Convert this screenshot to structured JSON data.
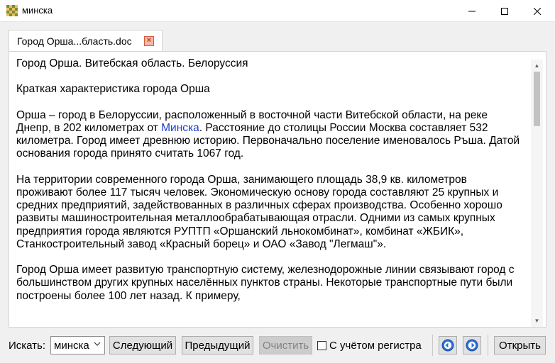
{
  "window": {
    "title": "минска",
    "controls": {
      "minimize": "—",
      "maximize": "☐",
      "close": "✕"
    }
  },
  "tab": {
    "label": "Город Орша...бласть.doc",
    "close_glyph": "×"
  },
  "document": {
    "paragraphs": [
      "Город Орша. Витебская область. Белоруссия",
      "Краткая характеристика города Орша"
    ],
    "para3_before_link": "Орша – город в Белоруссии, расположенный в восточной части Витебской области, на реке Днепр, в 202 километрах от ",
    "para3_link": "Минска",
    "para3_after_link": ". Расстояние до столицы России Москва составляет 532 километра. Город имеет древнюю историю. Первоначально поселение именовалось Ръша. Датой основания города принято считать 1067 год.",
    "para4": "На территории современного города Орша, занимающего площадь 38,9 кв. километров проживают более 117 тысяч человек. Экономическую основу города составляют 25 крупных и средних предприятий, задействованных в различных сферах производства. Особенно хорошо развиты машиностроительная металлообрабатывающая отрасли. Одними из самых крупных предприятия города являются РУПТП «Оршанский льнокомбинат», комбинат «ЖБИК», Станкостроительный завод «Красный борец» и ОАО «Завод \"Легмаш\"».",
    "para5": "Город Орша имеет развитую транспортную систему, железнодорожные линии связывают город с большинством других крупных населённых пунктов страны. Некоторые транспортные пути были построены более 100 лет назад. К примеру,"
  },
  "toolbar": {
    "search_label": "Искать:",
    "search_value": "минска",
    "next_label": "Следующий",
    "prev_label": "Предыдущий",
    "clear_label": "Очистить",
    "case_label": "С учётом регистра",
    "case_checked": false,
    "open_label": "Открыть"
  },
  "colors": {
    "link": "#1e3ec8",
    "nav_icon": "#2e6fd8",
    "tab_close": "#d65a3a"
  }
}
